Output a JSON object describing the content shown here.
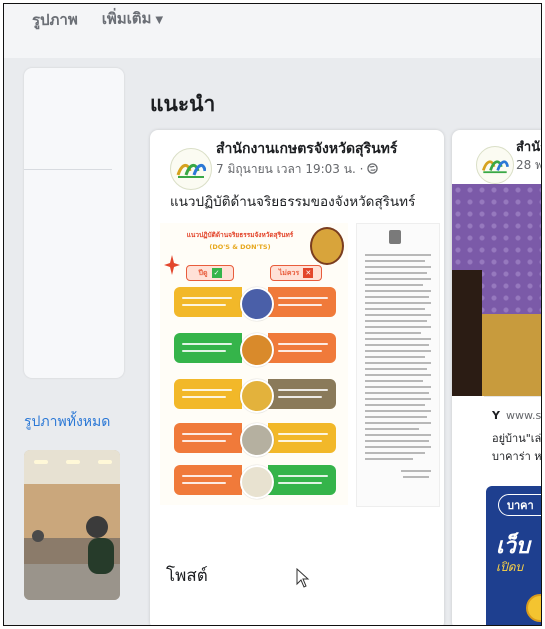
{
  "nav": {
    "tabs": [
      {
        "label": "รูปภาพ"
      },
      {
        "label": "เพิ่มเติม"
      }
    ]
  },
  "left": {
    "see_all_photos": "รูปภาพทั้งหมด"
  },
  "main": {
    "section_title": "แนะนำ",
    "post": {
      "page_name": "สำนักงานเกษตรจังหวัดสุรินทร์",
      "meta": "7 มิถุนายน เวลา 19:03 น. ·",
      "text": "แนวปฏิบัติด้านจริยธรรมของจังหวัดสุรินทร์",
      "poster": {
        "title": "แนวปฏิบัติด้านจริยธรรมจังหวัดสุรินทร์",
        "subtitle": "(DO'S & DON'TS)",
        "do_label": "ปีดู",
        "dont_label": "ไม่ควร"
      }
    },
    "posts_label": "โพสต์"
  },
  "second_card": {
    "page_name": "สำนัก",
    "meta": "28 พฤ",
    "ad": {
      "domain": "www.s",
      "text1": "อยู่บ้าน\"เล่น",
      "text2": "บาคาร่า หว",
      "pill": "บาคา",
      "big": "เว็บ",
      "small": "เปิดบ"
    }
  },
  "colors": {
    "accent_blue": "#2b78d6",
    "orange": "#f07a3a",
    "green": "#35b44a",
    "yellow": "#f2b829",
    "purple": "#7b5aa8"
  }
}
